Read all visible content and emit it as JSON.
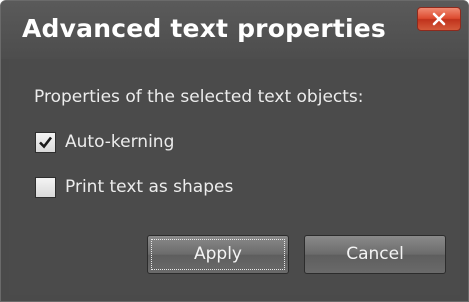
{
  "window": {
    "title": "Advanced text properties",
    "close_icon": "close-icon"
  },
  "content": {
    "prompt": "Properties of the selected text objects:",
    "options": [
      {
        "label": "Auto-kerning",
        "checked": true
      },
      {
        "label": "Print text as shapes",
        "checked": false
      }
    ]
  },
  "buttons": {
    "apply": "Apply",
    "cancel": "Cancel"
  },
  "colors": {
    "dialog_bg": "#4a4a4a",
    "close_button": "#dc4a2e",
    "text": "#ececec"
  }
}
